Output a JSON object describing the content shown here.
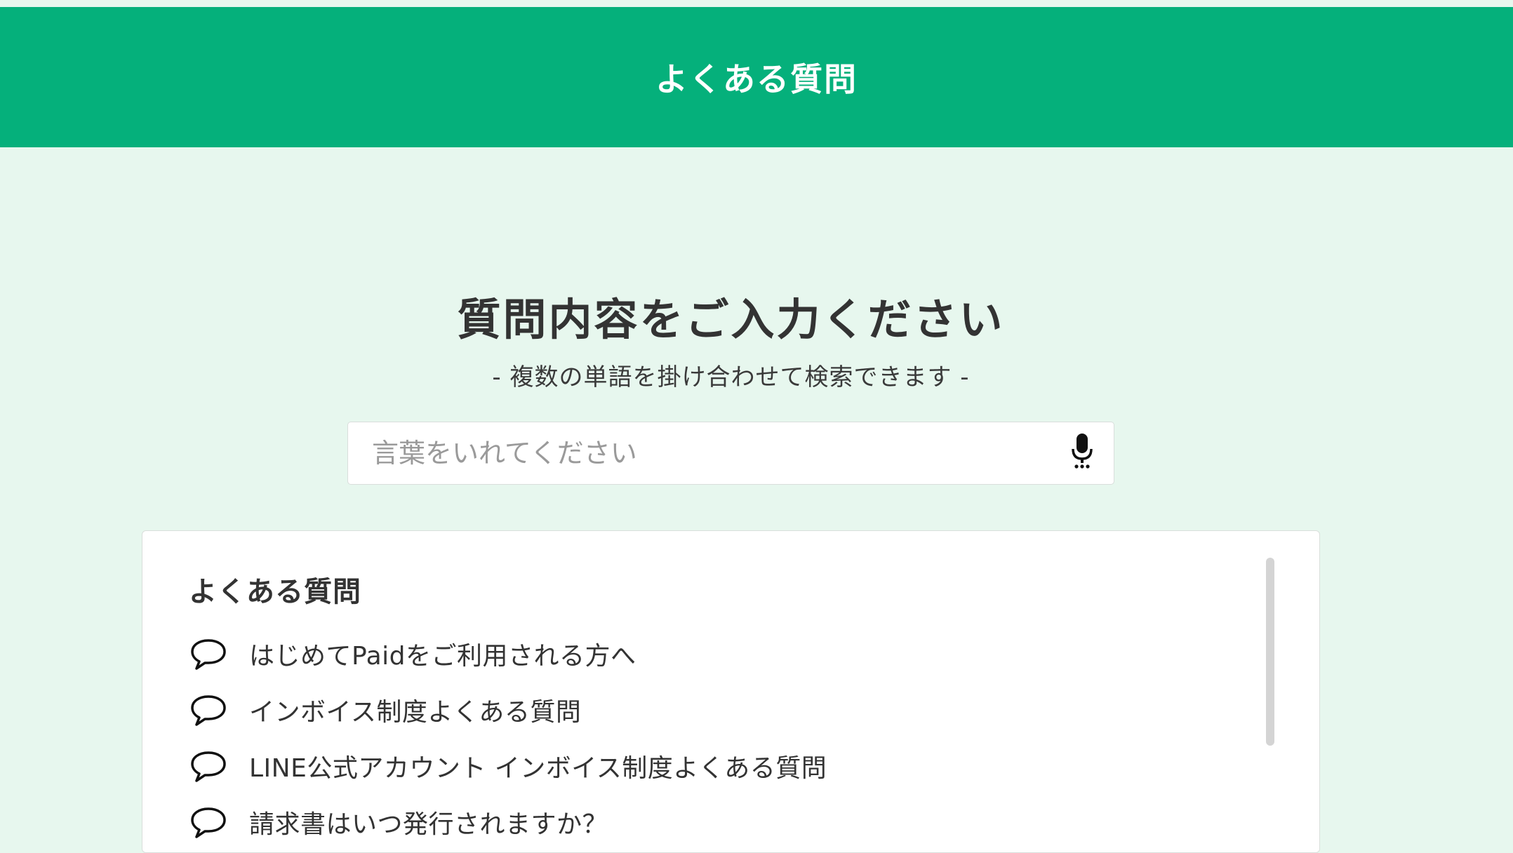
{
  "header": {
    "title": "よくある質問"
  },
  "hero": {
    "title": "質問内容をご入力ください",
    "subtitle": "- 複数の単語を掛け合わせて検索できます -"
  },
  "search": {
    "placeholder": "言葉をいれてください",
    "value": "",
    "mic_icon": "microphone-icon"
  },
  "faq": {
    "heading": "よくある質問",
    "item_icon": "speech-bubble-icon",
    "items": [
      {
        "label": "はじめてPaidをご利用される方へ"
      },
      {
        "label": "インボイス制度よくある質問"
      },
      {
        "label": "LINE公式アカウント インボイス制度よくある質問"
      },
      {
        "label": "請求書はいつ発行されますか？"
      }
    ]
  },
  "colors": {
    "brand": "#05b07b",
    "background": "#e7f7ee",
    "card": "#ffffff",
    "text": "#333333"
  }
}
